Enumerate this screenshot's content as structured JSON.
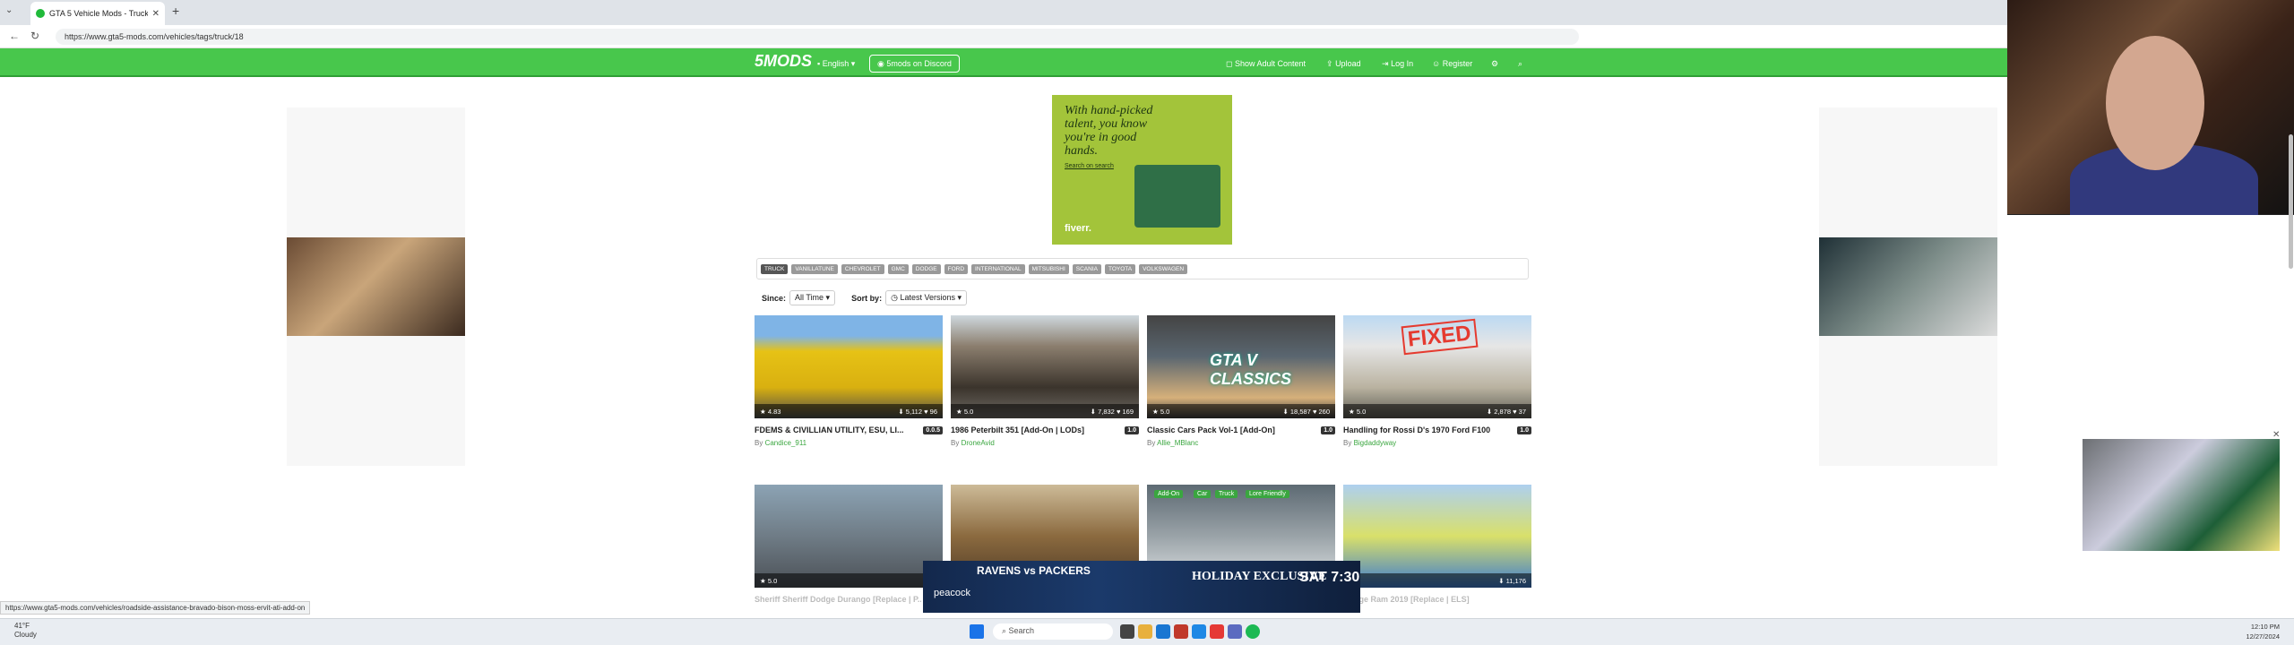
{
  "browser": {
    "tab_title": "GTA 5 Vehicle Mods - Truck - GTA",
    "url": "https://www.gta5-mods.com/vehicles/tags/truck/18",
    "status_url": "https://www.gta5-mods.com/vehicles/roadside-assistance-bravado-bison-moss-ervit-ati-add-on"
  },
  "header": {
    "logo": "5MODS",
    "language": "English",
    "discord": "5mods on Discord",
    "show_adult": "Show Adult Content",
    "upload": "Upload",
    "login": "Log In",
    "register": "Register"
  },
  "ads": {
    "top_text": "With hand-picked talent, you know you're in good hands.",
    "top_cta": "Search on search",
    "top_brand": "fiverr.",
    "bottom_title": "RAVENS vs PACKERS",
    "bottom_brand": "peacock",
    "bottom_holiday": "HOLIDAY EXCLUSIVE",
    "bottom_time": "SAT 7:30"
  },
  "tags": [
    "TRUCK",
    "VANILLATUNE",
    "CHEVROLET",
    "GMC",
    "DODGE",
    "FORD",
    "INTERNATIONAL",
    "MITSUBISHI",
    "SCANIA",
    "TOYOTA",
    "VOLKSWAGEN"
  ],
  "filters": {
    "since_label": "Since:",
    "since_value": "All Time",
    "sort_label": "Sort by:",
    "sort_value": "Latest Versions"
  },
  "cards": [
    {
      "title": "FDEMS & CIVILLIAN UTILITY, ESU, LI...",
      "version": "0.0.5",
      "author": "Candice_911",
      "rating": "4.83",
      "downloads": "5,112",
      "likes": "96"
    },
    {
      "title": "1986 Peterbilt 351 [Add-On | LODs]",
      "version": "1.0",
      "author": "DroneAvid",
      "rating": "5.0",
      "downloads": "7,832",
      "likes": "169"
    },
    {
      "title": "Classic Cars Pack Vol-1 [Add-On]",
      "version": "1.0",
      "author": "Allie_MBlanc",
      "rating": "5.0",
      "downloads": "18,587",
      "likes": "260"
    },
    {
      "title": "Handling for Rossi D's 1970 Ford F100",
      "version": "1.0",
      "author": "Bigdaddyway",
      "rating": "5.0",
      "downloads": "2,878",
      "likes": "37"
    },
    {
      "title": "Sheriff Sheriff Dodge Durango [Replace | P...",
      "version": "",
      "author": "",
      "rating": "5.0",
      "downloads": "",
      "likes": ""
    },
    {
      "title": "",
      "version": "",
      "author": "",
      "rating": "",
      "downloads": "",
      "likes": ""
    },
    {
      "title": "",
      "version": "",
      "author": "",
      "rating": "",
      "downloads": "",
      "likes": ""
    },
    {
      "title": "Dodge Ram 2019 [Replace | ELS]",
      "version": "",
      "author": "",
      "rating": "",
      "downloads": "11,176",
      "likes": ""
    }
  ],
  "card_overlays": {
    "fixed": "FIXED",
    "classics": "GTA V CLASSICS",
    "chips": [
      "Add-On",
      "Car",
      "Truck",
      "Lore Friendly"
    ]
  },
  "taskbar": {
    "weather_temp": "41°F",
    "weather_desc": "Cloudy",
    "search": "Search",
    "time": "12:10 PM",
    "date": "12/27/2024"
  }
}
